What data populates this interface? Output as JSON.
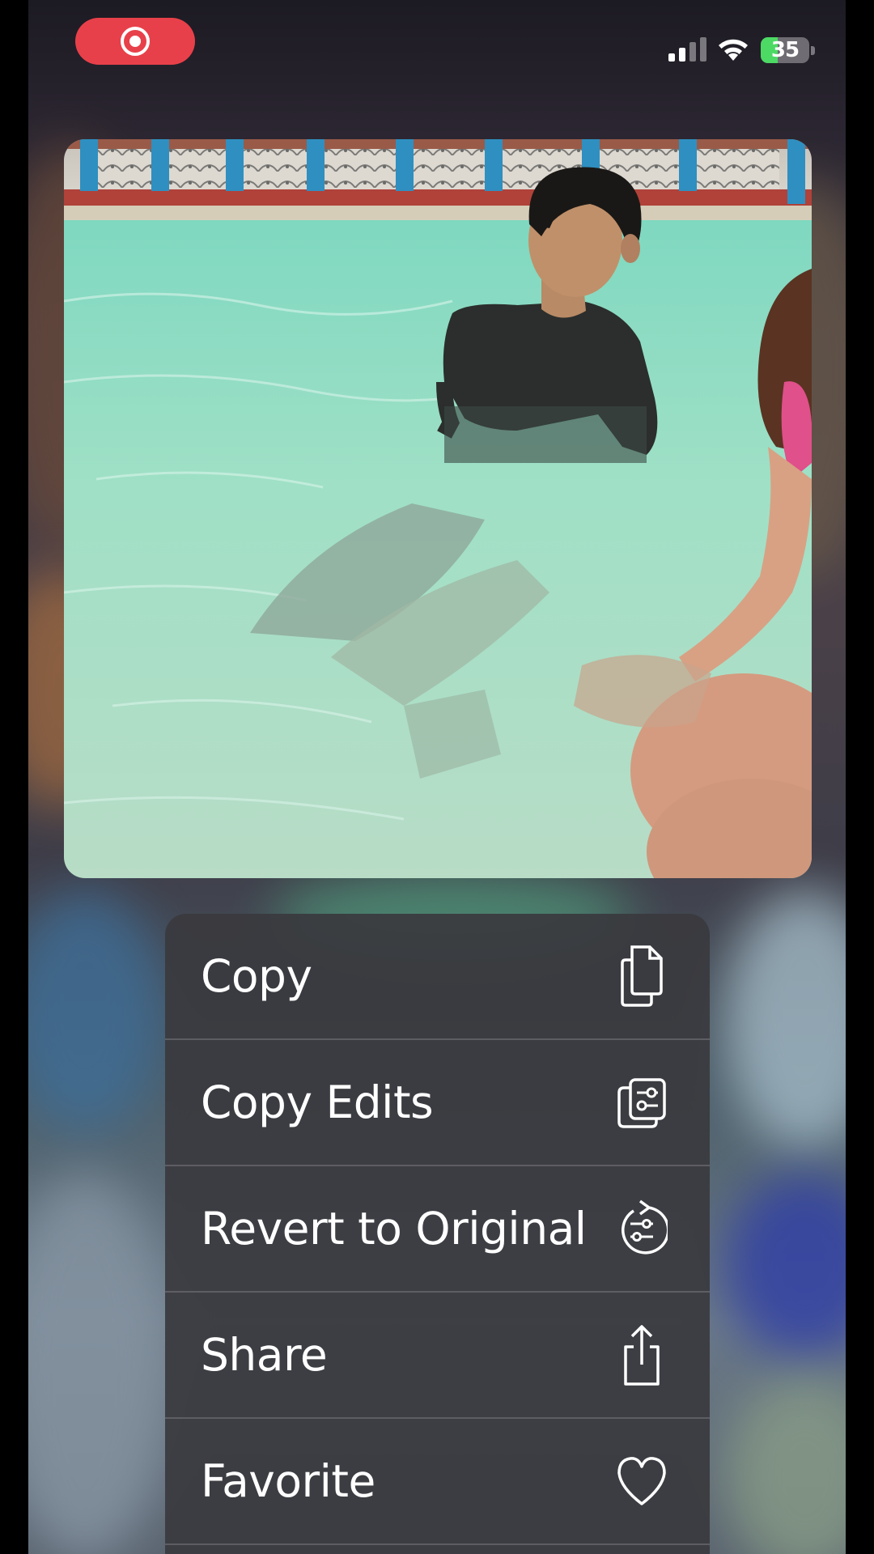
{
  "status_bar": {
    "battery_percent": "35",
    "battery_level": 0.35,
    "screen_recording": true,
    "charging": true
  },
  "photo": {
    "description_icon": "photo-preview"
  },
  "context_menu": {
    "items": [
      {
        "label": "Copy",
        "icon": "copy-icon"
      },
      {
        "label": "Copy Edits",
        "icon": "copy-edits-icon"
      },
      {
        "label": "Revert to Original",
        "icon": "revert-icon"
      },
      {
        "label": "Share",
        "icon": "share-icon"
      },
      {
        "label": "Favorite",
        "icon": "heart-icon"
      }
    ]
  },
  "colors": {
    "record_pill": "#e8404a",
    "battery_fill": "#4cd964",
    "menu_background": "#3a3a3e"
  }
}
